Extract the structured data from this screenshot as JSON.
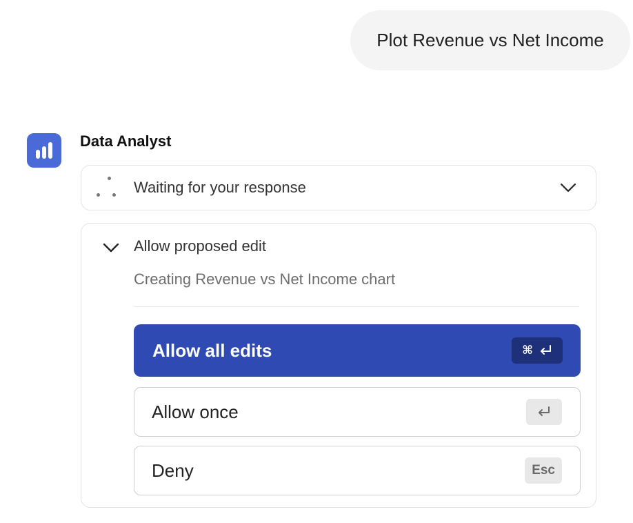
{
  "user_message": {
    "text": "Plot Revenue vs Net Income"
  },
  "agent": {
    "name": "Data Analyst",
    "avatar_icon": "bar-chart-icon",
    "avatar_color": "#4a6ad8"
  },
  "status": {
    "text": "Waiting for your response",
    "icon": "spinner-dots-icon",
    "expand_icon": "chevron-down-icon"
  },
  "permission": {
    "title": "Allow proposed edit",
    "description": "Creating Revenue vs Net Income chart",
    "collapse_icon": "chevron-down-icon",
    "options": [
      {
        "label": "Allow all edits",
        "shortcut_symbol": "⌘",
        "shortcut_icon": "return-icon",
        "color": "#2f4bb3"
      },
      {
        "label": "Allow once",
        "shortcut_icon": "return-icon"
      },
      {
        "label": "Deny",
        "shortcut_text": "Esc"
      }
    ]
  }
}
